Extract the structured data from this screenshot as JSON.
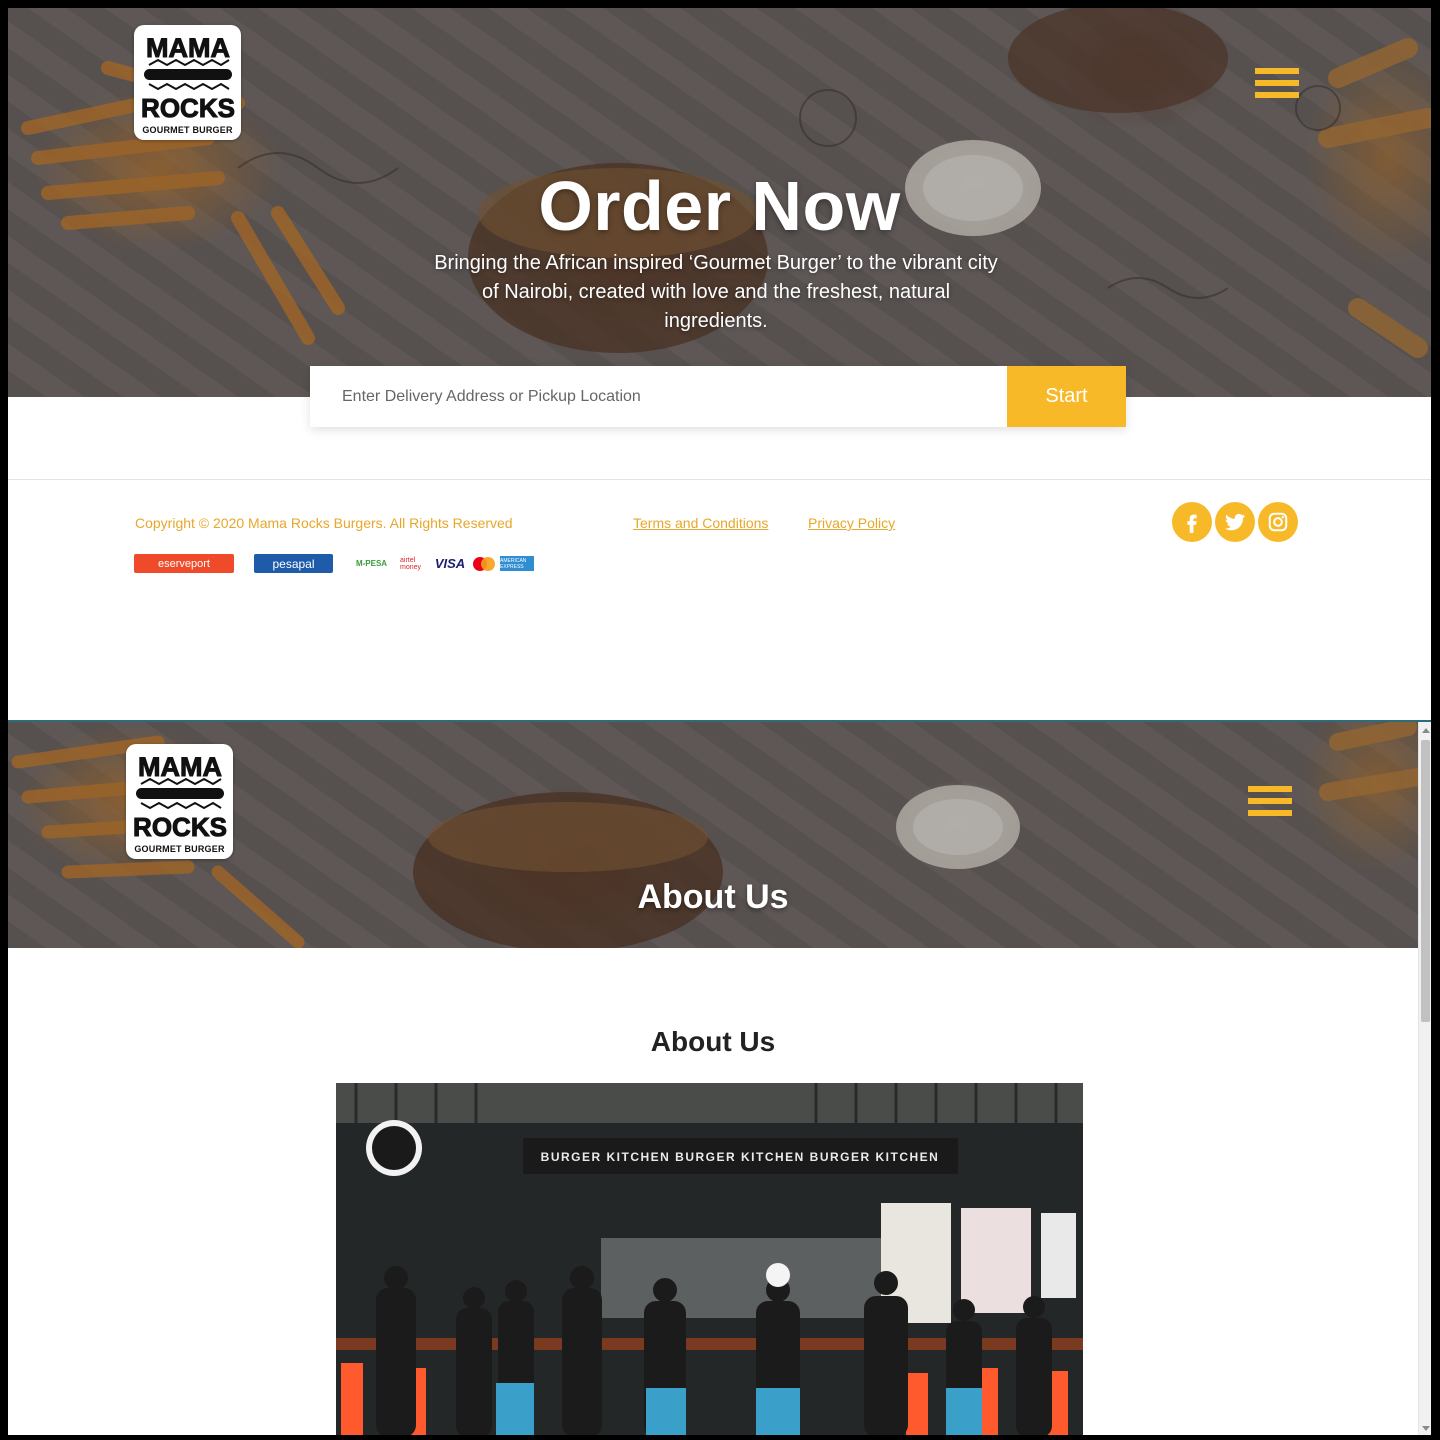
{
  "brand": {
    "logo_top": "MAMA",
    "logo_bottom": "ROCKS",
    "logo_sub": "GOURMET BURGER"
  },
  "hero": {
    "title": "Order Now",
    "text": "Bringing the African inspired ‘Gourmet Burger’ to the vibrant city of Nairobi, created with love and the freshest, natural ingredients."
  },
  "search": {
    "placeholder": "Enter Delivery Address or Pickup Location",
    "button_label": "Start"
  },
  "footer": {
    "copyright": "Copyright © 2020 Mama Rocks Burgers. All Rights Reserved",
    "links": [
      "Terms and Conditions",
      "Privacy Policy"
    ],
    "social_icons": [
      "facebook-icon",
      "twitter-icon",
      "instagram-icon"
    ],
    "payments": {
      "reserveport": "eserveport",
      "pesapal": "pesapal",
      "mpesa": "M-PESA",
      "airtel": "airtel money",
      "visa": "VISA",
      "mastercard": "mastercard-icon",
      "amex": "AMERICAN EXPRESS"
    }
  },
  "about": {
    "banner_title": "About Us",
    "heading": "About Us",
    "photo_banner": "BURGER KITCHEN   BURGER KITCHEN   BURGER KITCHEN"
  },
  "colors": {
    "accent": "#f7b928",
    "link": "#e8a72a",
    "text_dark": "#222222"
  }
}
